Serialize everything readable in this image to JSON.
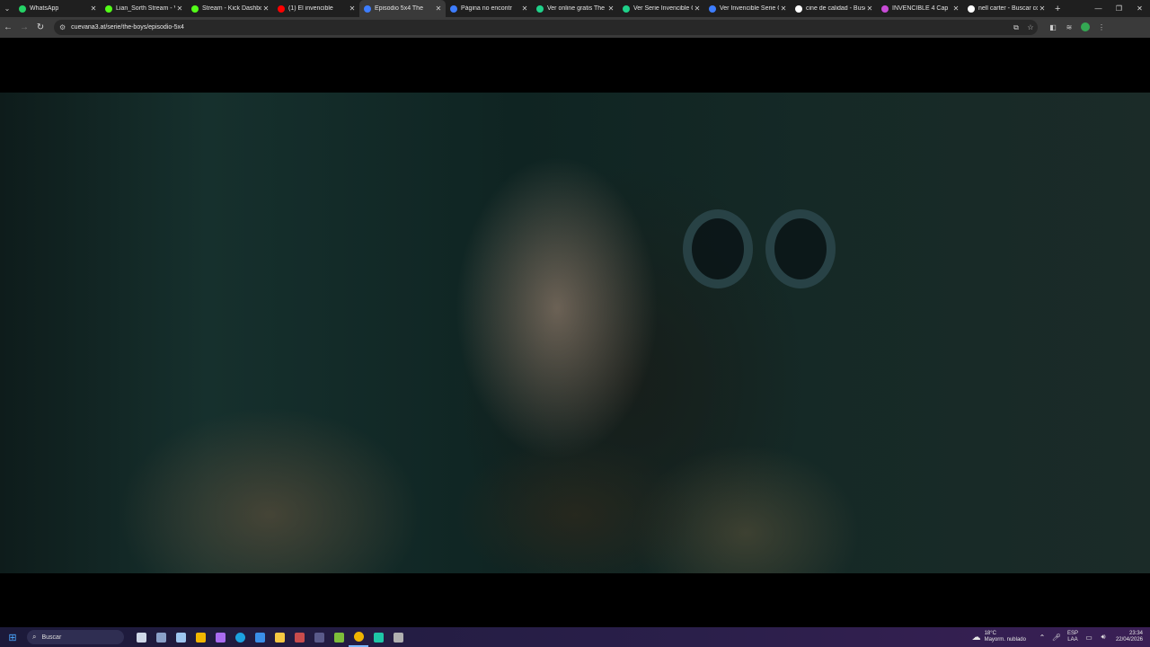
{
  "tabs": [
    {
      "title": "WhatsApp",
      "favicon": "whatsapp-icon",
      "color": "#25d366",
      "active": false
    },
    {
      "title": "Lian_Sorth Stream - V",
      "favicon": "kick-icon",
      "color": "#53fc18",
      "active": false
    },
    {
      "title": "Stream - Kick Dashbo",
      "favicon": "kick-icon",
      "color": "#53fc18",
      "active": false
    },
    {
      "title": "(1) El invencible",
      "favicon": "youtube-icon",
      "color": "#ff0000",
      "active": false
    },
    {
      "title": "Episodio 5x4 The",
      "favicon": "cuevana-icon",
      "color": "#3d7dff",
      "active": true
    },
    {
      "title": "Página no encontr",
      "favicon": "cuevana-icon",
      "color": "#3d7dff",
      "active": false
    },
    {
      "title": "Ver online gratis The",
      "favicon": "cuevana-green-icon",
      "color": "#1fd18a",
      "active": false
    },
    {
      "title": "Ver Serie Invencible O",
      "favicon": "cuevana-green-icon",
      "color": "#1fd18a",
      "active": false
    },
    {
      "title": "Ver Invencible Serie C",
      "favicon": "cuevana-icon",
      "color": "#3d7dff",
      "active": false
    },
    {
      "title": "cine de calidad - Busc",
      "favicon": "google-icon",
      "color": "#ffffff",
      "active": false
    },
    {
      "title": "INVENCIBLE 4 Cap",
      "favicon": "site-icon",
      "color": "#c84bd6",
      "active": false
    },
    {
      "title": "nell carter - Buscar co",
      "favicon": "google-icon",
      "color": "#ffffff",
      "active": false
    }
  ],
  "toolbar": {
    "url": "cuevana3.at/serie/the-boys/episodio-5x4"
  },
  "taskbar": {
    "search_label": "Buscar",
    "weather_temp": "18°C",
    "weather_desc": "Mayorm. nublado",
    "lang_top": "ESP",
    "lang_bottom": "LAA",
    "time": "23:34",
    "date": "22/04/2026",
    "apps": [
      {
        "name": "task-view-icon",
        "color": "#cfd8e8"
      },
      {
        "name": "app-icon",
        "color": "#8aa0c8"
      },
      {
        "name": "steam-icon",
        "color": "#9ec6f0"
      },
      {
        "name": "app-yellow-icon",
        "color": "#f2b600"
      },
      {
        "name": "app-purple-icon",
        "color": "#a96bf0"
      },
      {
        "name": "edge-icon",
        "color": "#1ca2e0"
      },
      {
        "name": "store-icon",
        "color": "#3a8fe8"
      },
      {
        "name": "file-explorer-icon",
        "color": "#f5c842"
      },
      {
        "name": "app-red-icon",
        "color": "#c94c4c"
      },
      {
        "name": "app-dark-icon",
        "color": "#5a5a8a"
      },
      {
        "name": "app-green-icon",
        "color": "#7dbe3a"
      },
      {
        "name": "chrome-icon",
        "color": "#f0b400"
      },
      {
        "name": "app-teal-icon",
        "color": "#1ec7a6"
      },
      {
        "name": "app-gray-icon",
        "color": "#b0b0b0"
      }
    ]
  }
}
